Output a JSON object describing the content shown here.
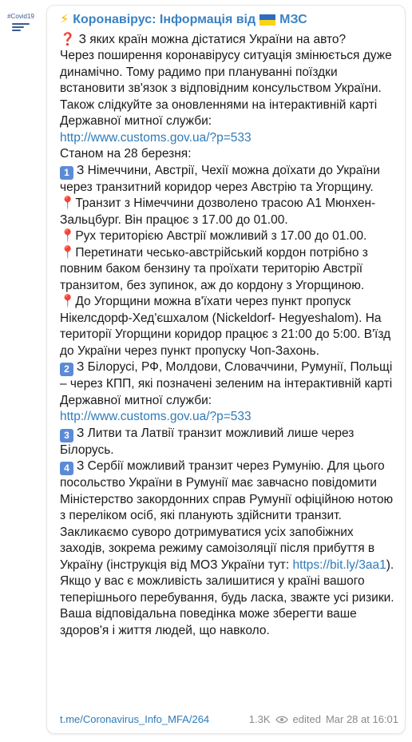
{
  "avatar": {
    "tag": "#Covid19"
  },
  "channel": {
    "title": "Коронавірус: Інформація від",
    "title_suffix": "МЗС"
  },
  "post": {
    "question": "З яких країн можна дістатися України на авто?",
    "intro": "Через поширення коронавірусу ситуація змінюється дуже динамічно. Тому радимо при плануванні поїздки встановити зв'язок з відповідним консульством України. Також слідкуйте за оновленнями на інтерактивній карті Державної митної служби:",
    "link1": "http://www.customs.gov.ua/?p=533",
    "as_of": "Станом на 28 березня:",
    "item1_num": "1",
    "item1": "З Німеччини, Австрії, Чехії можна доїхати до України через транзитний коридор через Австрію та Угорщину.",
    "pin1": "Транзит з Німеччини дозволено трасою А1 Мюнхен-Зальцбург. Він працює з 17.00 до 01.00.",
    "pin2": "Рух територією Австрії можливий з 17.00 до 01.00.",
    "pin3": "Перетинати чесько-австрійський кордон потрібно з повним баком бензину та проїхати територію Австрії транзитом, без зупинок, аж до кордону з Угорщиною.",
    "pin4": "До Угорщини можна в'їхати через пункт пропуск Нікелсдорф-Хед'єшхалом (Nickeldorf- Hegyeshalom). На території Угорщини коридор працює з 21:00 до 5:00. В'їзд до України через пункт пропуску Чоп-Захонь.",
    "item2_num": "2",
    "item2": "З Білорусі, РФ, Молдови, Словаччини, Румунії, Польщі – через КПП, які позначені зеленим на інтерактивній карті Державної митної служби:",
    "link2": "http://www.customs.gov.ua/?p=533",
    "item3_num": "3",
    "item3": "З Литви та Латвії транзит можливий лише через Білорусь.",
    "item4_num": "4",
    "item4": "З Сербії можливий транзит через Румунію. Для цього посольство України в Румунії має завчасно повідомити Міністерство закордонних справ Румунії офіційною нотою з переліком осіб, які планують здійснити транзит.",
    "appeal_text": "Закликаємо суворо дотримуватися усіх запобіжних заходів, зокрема режиму самоізоляції після прибуття в Україну (інструкція від МОЗ України тут:",
    "appeal_link": "https://bit.ly/3aa1",
    "appeal_end": ").",
    "closing": "Якщо у вас є можливість залишитися у країні вашого теперішнього перебування, будь ласка, зважте усі ризики. Ваша відповідальна поведінка може зберегти ваше здоров'я і життя людей, що навколо."
  },
  "footer": {
    "post_link": "t.me/Coronavirus_Info_MFA/264",
    "views": "1.3K",
    "edited": "edited",
    "time": "Mar 28 at 16:01"
  },
  "colors": {
    "title": "#3a82c4",
    "link": "#2f7bb8",
    "badge": "#5c8bd6"
  }
}
